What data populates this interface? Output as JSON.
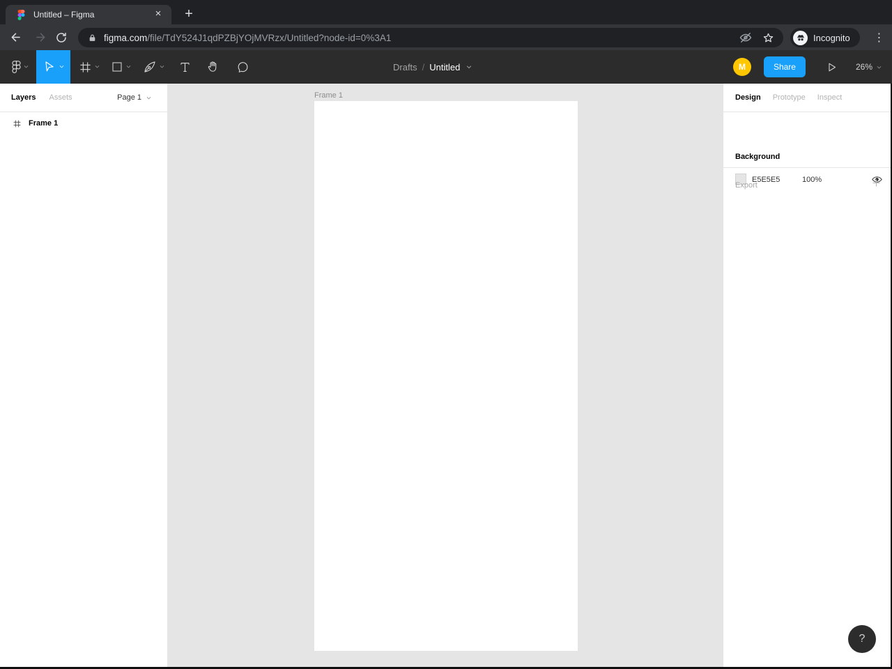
{
  "browser": {
    "tab_title": "Untitled – Figma",
    "url_domain": "figma.com",
    "url_path": "/file/TdY524J1qdPZBjYOjMVRzx/Untitled?node-id=0%3A1",
    "incognito_label": "Incognito"
  },
  "icons": {
    "close": "×",
    "plus": "+",
    "menu_dots": "⋮",
    "question": "?"
  },
  "toolbar": {
    "breadcrumb_parent": "Drafts",
    "breadcrumb_separator": "/",
    "breadcrumb_current": "Untitled",
    "avatar_initial": "M",
    "share_label": "Share",
    "zoom_level": "26%"
  },
  "left_panel": {
    "tab_layers": "Layers",
    "tab_assets": "Assets",
    "page_selector": "Page 1",
    "layers": [
      {
        "name": "Frame 1"
      }
    ]
  },
  "canvas": {
    "frame_label": "Frame 1"
  },
  "right_panel": {
    "tab_design": "Design",
    "tab_prototype": "Prototype",
    "tab_inspect": "Inspect",
    "background_title": "Background",
    "background_hex": "E5E5E5",
    "background_opacity": "100%",
    "export_title": "Export"
  },
  "colors": {
    "accent-blue": "#18a0fb",
    "avatar-yellow": "#ffc700",
    "canvas-bg": "#e5e5e5",
    "swatch": "#e5e5e5"
  }
}
